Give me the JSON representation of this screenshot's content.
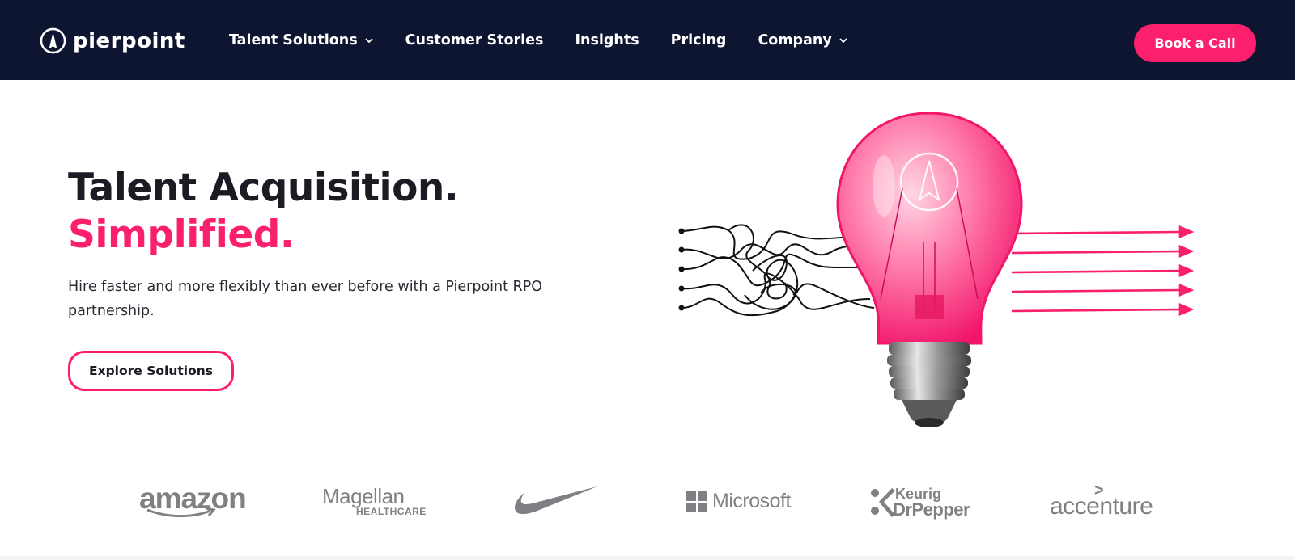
{
  "header": {
    "logo_text": "pierpoint",
    "nav": [
      {
        "label": "Talent Solutions",
        "has_dropdown": true
      },
      {
        "label": "Customer Stories",
        "has_dropdown": false
      },
      {
        "label": "Insights",
        "has_dropdown": false
      },
      {
        "label": "Pricing",
        "has_dropdown": false
      },
      {
        "label": "Company",
        "has_dropdown": true
      }
    ],
    "cta_label": "Book a Call"
  },
  "hero": {
    "title_line1": "Talent Acquisition.",
    "title_line2": "Simplified.",
    "subtitle": "Hire faster and more flexibly than ever before with a Pierpoint RPO partnership.",
    "button_label": "Explore Solutions"
  },
  "client_logos": {
    "amazon": "amazon",
    "magellan": "Magellan",
    "magellan_sub": "HEALTHCARE",
    "nike": "nike-swoosh",
    "microsoft": "Microsoft",
    "keurig": "Keurig",
    "drpepper": "DrPepper",
    "accenture": "accenture",
    "accenture_mark": ">"
  },
  "colors": {
    "navbar_bg": "#0e1530",
    "accent_pink": "#fb1f6e",
    "logo_gray": "#808084",
    "text_dark": "#1b1b24"
  },
  "icons": {
    "logo": "pierpoint-compass-icon",
    "dropdown": "chevron-down-icon",
    "illustration": "lightbulb-tangled-wires-icon"
  }
}
